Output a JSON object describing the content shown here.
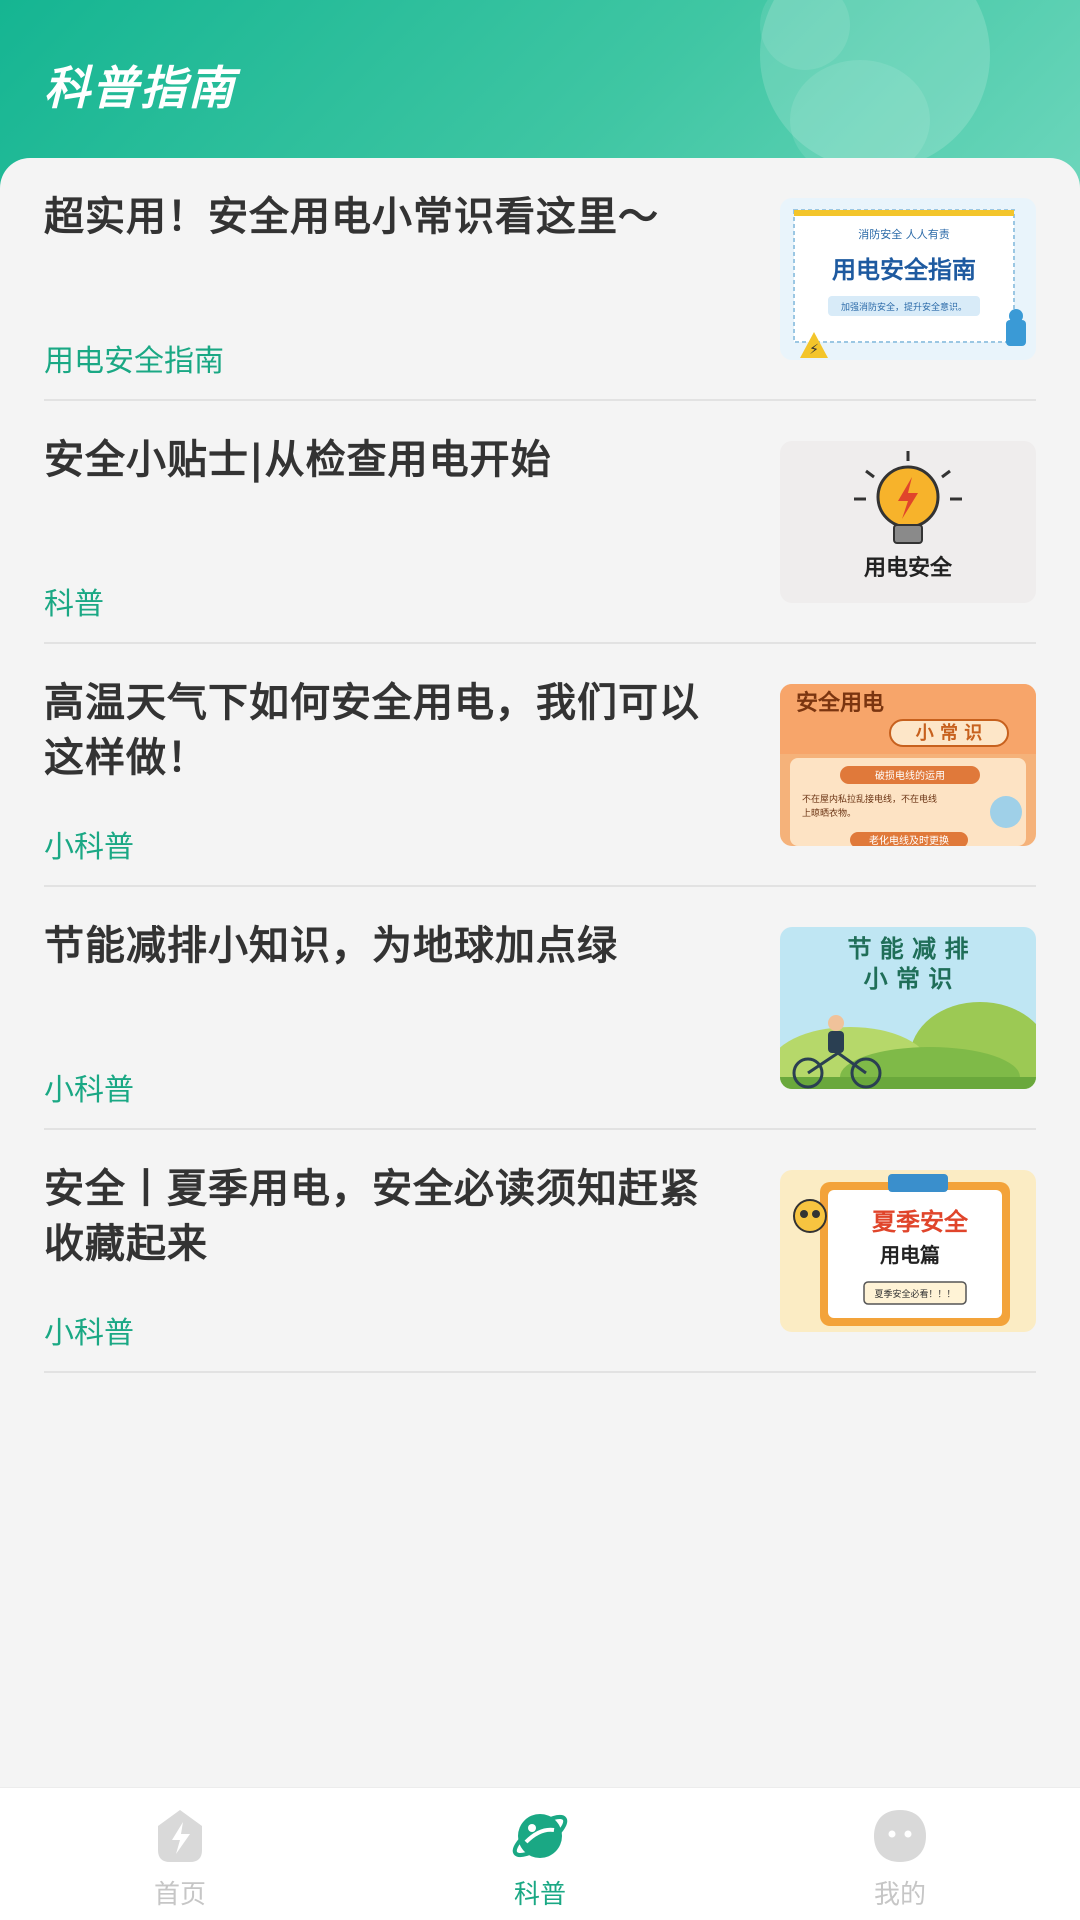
{
  "header": {
    "title": "科普指南"
  },
  "articles": [
    {
      "title": "超实用！安全用电小常识看这里～",
      "tag": "用电安全指南",
      "thumb": "electric-safety-guide-thumbnail"
    },
    {
      "title": "安全小贴士|从检查用电开始",
      "tag": "科普",
      "thumb": "lightbulb-safety-thumbnail"
    },
    {
      "title": "高温天气下如何安全用电，我们可以这样做！",
      "tag": "小科普",
      "thumb": "safety-tips-poster-thumbnail"
    },
    {
      "title": "节能减排小知识，为地球加点绿",
      "tag": "小科普",
      "thumb": "energy-saving-cyclist-thumbnail"
    },
    {
      "title": "安全丨夏季用电，安全必读须知赶紧收藏起来",
      "tag": "小科普",
      "thumb": "summer-safety-clipboard-thumbnail"
    }
  ],
  "thumbs": {
    "t1": {
      "top": "消防安全  人人有责",
      "main": "用电安全指南",
      "sub": "加强消防安全，提升安全意识。"
    },
    "t2": {
      "main": "用电安全"
    },
    "t3": {
      "main": "安全用电",
      "sub": "小 常 识",
      "pill": "破损电线的运用",
      "body1": "不在屋内私拉乱接电线，不在电线",
      "body2": "上晾晒衣物。",
      "bottom": "老化电线及时更换"
    },
    "t4": {
      "line1": "节 能 减 排",
      "line2": "小 常 识"
    },
    "t5": {
      "main": "夏季安全",
      "sub": "用电篇",
      "note": "夏季安全必看！！！"
    }
  },
  "tabbar": {
    "items": [
      {
        "label": "首页",
        "icon": "lightning-home-icon",
        "active": false
      },
      {
        "label": "科普",
        "icon": "planet-icon",
        "active": true
      },
      {
        "label": "我的",
        "icon": "face-profile-icon",
        "active": false
      }
    ],
    "active_color": "#1aa884",
    "inactive_color": "#c6c6c6"
  },
  "colors": {
    "accent": "#1aa884",
    "header": "#15b592"
  }
}
